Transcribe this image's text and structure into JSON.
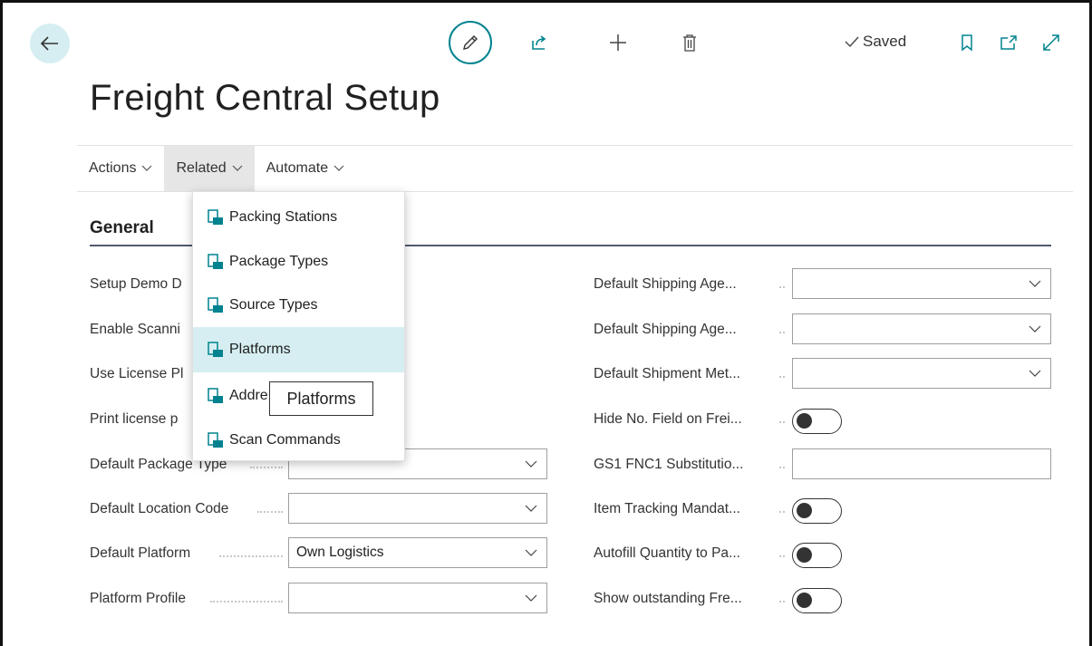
{
  "toolbar": {
    "saved_label": "Saved"
  },
  "page": {
    "title": "Freight Central Setup"
  },
  "actionbar": {
    "items": [
      {
        "label": "Actions"
      },
      {
        "label": "Related"
      },
      {
        "label": "Automate"
      }
    ]
  },
  "section": {
    "title": "General"
  },
  "left_fields": [
    {
      "label": "Setup Demo D"
    },
    {
      "label": "Enable Scanni"
    },
    {
      "label": "Use License Pl"
    },
    {
      "label": "Print license p"
    },
    {
      "label": "Default Package Type",
      "value": ""
    },
    {
      "label": "Default Location Code",
      "value": ""
    },
    {
      "label": "Default Platform",
      "value": "Own Logistics"
    },
    {
      "label": "Platform Profile",
      "value": ""
    }
  ],
  "right_fields": [
    {
      "label": "Default Shipping Age...",
      "value": ""
    },
    {
      "label": "Default Shipping Age...",
      "value": ""
    },
    {
      "label": "Default Shipment Met...",
      "value": ""
    },
    {
      "label": "Hide No. Field on Frei...",
      "toggle": false
    },
    {
      "label": "GS1 FNC1 Substitutio...",
      "value": ""
    },
    {
      "label": "Item Tracking Mandat...",
      "toggle": false
    },
    {
      "label": "Autofill Quantity to Pa...",
      "toggle": false
    },
    {
      "label": "Show outstanding Fre...",
      "toggle": false
    }
  ],
  "related_menu": {
    "items": [
      {
        "label": "Packing Stations"
      },
      {
        "label": "Package Types"
      },
      {
        "label": "Source Types"
      },
      {
        "label": "Platforms"
      },
      {
        "label": "Addre"
      },
      {
        "label": "Scan Commands"
      }
    ],
    "highlighted_index": 3
  },
  "tooltip": {
    "text": "Platforms"
  },
  "colors": {
    "accent": "#00838f",
    "highlight": "#d6eef1",
    "icon_teal": "#00838f"
  }
}
